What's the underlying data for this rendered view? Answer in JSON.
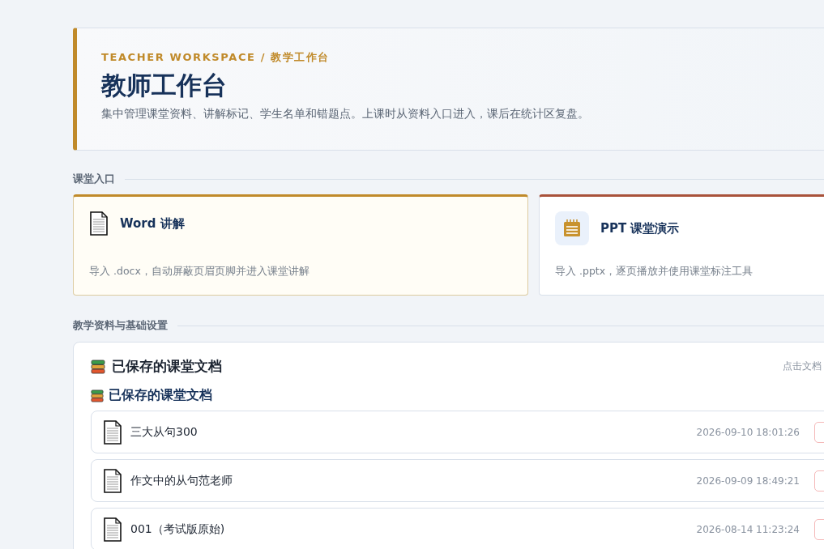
{
  "header": {
    "eyebrow": "TEACHER WORKSPACE / 教学工作台",
    "title": "教师工作台",
    "description": "集中管理课堂资料、讲解标记、学生名单和错题点。上课时从资料入口进入，课后在统计区复盘。"
  },
  "entry_section": {
    "label": "课堂入口"
  },
  "entries": [
    {
      "kind": "document",
      "title": "Word 讲解",
      "description": "导入 .docx，自动屏蔽页眉页脚并进入课堂讲解",
      "color": "#c08a2a",
      "selected": true
    },
    {
      "kind": "notepad",
      "title": "PPT 课堂演示",
      "description": "导入 .pptx，逐页播放并使用课堂标注工具",
      "color": "#a9523a",
      "selected": false
    }
  ],
  "materials_section": {
    "label": "教学资料与基础设置"
  },
  "documents_panel": {
    "title": "已保存的课堂文档",
    "hint": "点击文档",
    "subtitle": "已保存的课堂文档",
    "documents": [
      {
        "name": "三大从句300",
        "time": "2026-09-10 18:01:26"
      },
      {
        "name": "作文中的从句范老师",
        "time": "2026-09-09 18:49:21"
      },
      {
        "name": "001（考试版原始)",
        "time": "2026-08-14 11:23:24"
      }
    ]
  }
}
